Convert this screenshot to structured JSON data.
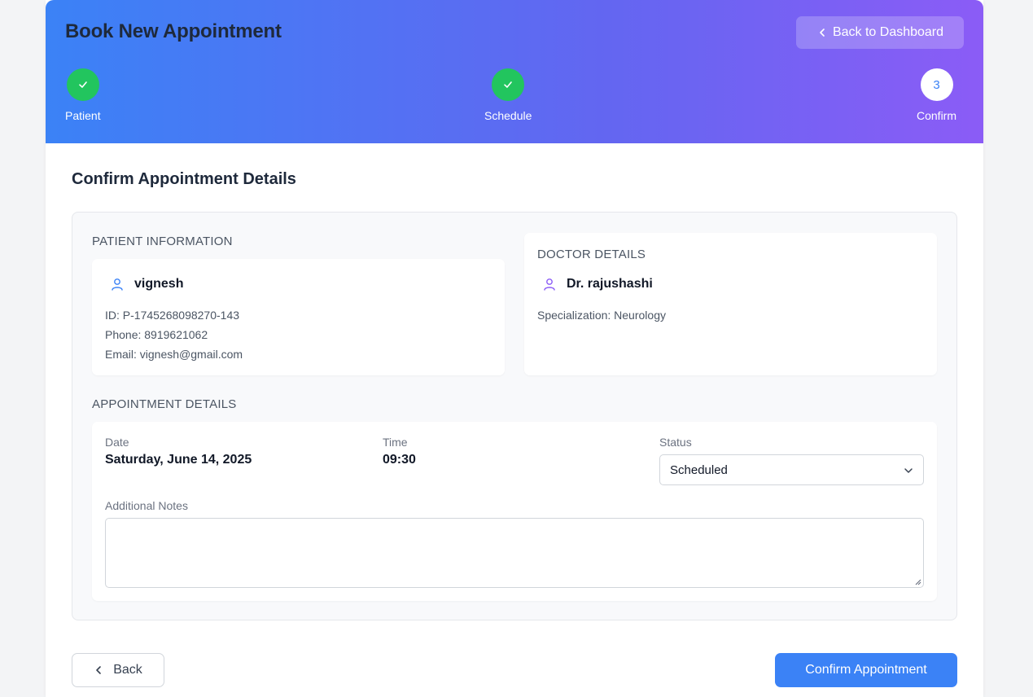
{
  "header": {
    "title": "Book New Appointment",
    "back_to_dashboard": "Back to Dashboard"
  },
  "steps": [
    {
      "label": "Patient",
      "state": "complete"
    },
    {
      "label": "Schedule",
      "state": "complete"
    },
    {
      "label": "Confirm",
      "state": "current",
      "number": "3"
    }
  ],
  "main": {
    "section_title": "Confirm Appointment Details",
    "patient": {
      "group_label": "PATIENT INFORMATION",
      "name": "vignesh",
      "id_line": "ID: P-1745268098270-143",
      "phone_line": "Phone: 8919621062",
      "email_line": "Email: vignesh@gmail.com",
      "icon": "user-icon"
    },
    "doctor": {
      "group_label": "DOCTOR DETAILS",
      "name": "Dr. rajushashi",
      "specialization_line": "Specialization: Neurology",
      "icon": "user-icon"
    },
    "appointment": {
      "group_label": "APPOINTMENT DETAILS",
      "date_label": "Date",
      "date_value": "Saturday, June 14, 2025",
      "time_label": "Time",
      "time_value": "09:30",
      "status_label": "Status",
      "status_value": "Scheduled",
      "notes_label": "Additional Notes",
      "notes_value": ""
    }
  },
  "footer": {
    "back_label": "Back",
    "confirm_label": "Confirm Appointment"
  },
  "colors": {
    "gradient_start": "#3b82f6",
    "gradient_end": "#8b5cf6",
    "step_complete": "#22c55e",
    "primary_button": "#3b82f6",
    "patient_icon": "#3b82f6",
    "doctor_icon": "#8b5cf6"
  }
}
